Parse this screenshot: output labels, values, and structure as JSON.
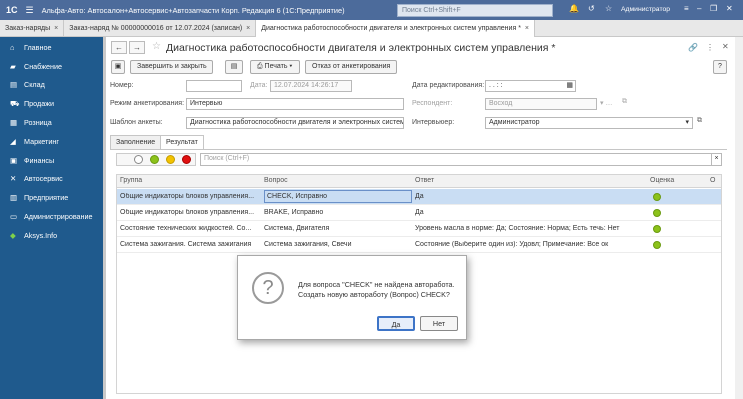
{
  "titlebar": {
    "logo": "1С",
    "app_title": "Альфа-Авто: Автосалон+Автосервис+Автозапчасти Корп. Редакция 6  (1С:Предприятие)",
    "search_placeholder": "Поиск Ctrl+Shift+F",
    "user": "Администратор"
  },
  "tabs": [
    {
      "label": "Заказ-наряды",
      "closable": true
    },
    {
      "label": "Заказ-наряд № 00000000016 от 12.07.2024 (записан)",
      "closable": true
    },
    {
      "label": "Диагностика работоспособности двигателя и электронных систем управления *",
      "closable": true
    }
  ],
  "sidebar": {
    "items": [
      {
        "label": "Главное",
        "icon": "home-icon"
      },
      {
        "label": "Снабжение",
        "icon": "truck-icon"
      },
      {
        "label": "Склад",
        "icon": "warehouse-icon"
      },
      {
        "label": "Продажи",
        "icon": "cart-icon"
      },
      {
        "label": "Розница",
        "icon": "retail-icon"
      },
      {
        "label": "Маркетинг",
        "icon": "marketing-icon"
      },
      {
        "label": "Финансы",
        "icon": "finance-icon"
      },
      {
        "label": "Автосервис",
        "icon": "wrench-icon"
      },
      {
        "label": "Предприятие",
        "icon": "enterprise-icon"
      },
      {
        "label": "Администрирование",
        "icon": "admin-icon"
      },
      {
        "label": "Aksys.Info",
        "icon": "aksys-icon"
      }
    ]
  },
  "form": {
    "title": "Диагностика работоспособности двигателя и электронных систем управления *",
    "toolbar": {
      "save_close": "Завершить и закрыть",
      "print": "Печать",
      "refuse": "Отказ от анкетирования"
    },
    "fields": {
      "number_label": "Номер:",
      "number_value": "",
      "date_label": "Дата:",
      "date_value": "12.07.2024 14:26:17",
      "edit_date_label": "Дата редактирования:",
      "edit_date_value": " .  .     :  :",
      "mode_label": "Режим анкетирования:",
      "mode_value": "Интервью",
      "respondent_label": "Респондент:",
      "respondent_value": "Восход",
      "template_label": "Шаблон анкеты:",
      "template_value": "Диагностика работоспособности двигателя и электронных систем упр",
      "interviewer_label": "Интервьюер:",
      "interviewer_value": "Администратор"
    },
    "form_tabs": [
      {
        "label": "Заполнение",
        "active": false
      },
      {
        "label": "Результат",
        "active": true
      }
    ],
    "result_search_placeholder": "Поиск (Ctrl+F)",
    "grid": {
      "columns": [
        "Группа",
        "Вопрос",
        "Ответ",
        "Оценка",
        "О"
      ],
      "rows": [
        {
          "group": "Общие индикаторы блоков управления...",
          "question": "CHECK, Исправно",
          "answer": "Да",
          "rating": "green",
          "selected": true
        },
        {
          "group": "Общие индикаторы блоков управления...",
          "question": "BRAKE, Исправно",
          "answer": "Да",
          "rating": "green",
          "selected": false
        },
        {
          "group": "Состояние технических жидкостей. Со...",
          "question": "Система, Двигателя",
          "answer": "Уровень масла в норме: Да; Состояние: Норма; Есть течь: Нет",
          "rating": "green",
          "selected": false
        },
        {
          "group": "Система зажигания. Система зажигания",
          "question": "Система зажигания, Свечи",
          "answer": "Состояние (Выберите один из): Удовл; Примечание: Все ок",
          "rating": "green",
          "selected": false
        }
      ]
    }
  },
  "dialog": {
    "line1": "Для вопроса \"CHECK\" не найдена авторабота.",
    "line2": "Создать новую автоработу (Вопрос) CHECK?",
    "yes": "Да",
    "no": "Нет"
  }
}
